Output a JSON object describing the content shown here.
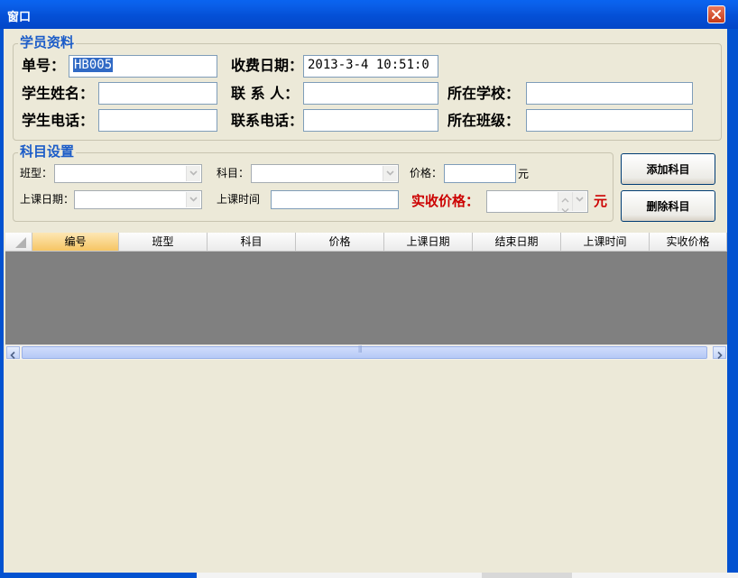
{
  "window": {
    "title": "窗口"
  },
  "student": {
    "group_title": "学员资料",
    "order_label": "单号：",
    "order_value": "HB005",
    "date_label": "收费日期：",
    "date_value": "2013-3-4 10:51:0",
    "name_label": "学生姓名：",
    "contact_label": "联 系 人：",
    "school_label": "所在学校：",
    "phone_label": "学生电话：",
    "contact_phone_label": "联系电话：",
    "class_label": "所在班级："
  },
  "subject": {
    "group_title": "科目设置",
    "class_type_label": "班型：",
    "subject_label": "科目：",
    "price_label": "价格：",
    "unit": "元",
    "start_date_label": "上课日期：",
    "start_time_label": "上课时间",
    "actual_price_label": "实收价格：",
    "actual_unit": "元"
  },
  "buttons": {
    "add": "添加科目",
    "delete": "删除科目"
  },
  "grid": {
    "columns": [
      "编号",
      "班型",
      "科目",
      "价格",
      "上课日期",
      "结束日期",
      "上课时间",
      "实收价格"
    ]
  },
  "scrollbar": {
    "thumb_grip": "⦀"
  },
  "colors": {
    "title_bar": "#0450d6",
    "group_title": "#1b5cc8",
    "accent_red": "#cc0000",
    "grid_bg": "#808080"
  }
}
